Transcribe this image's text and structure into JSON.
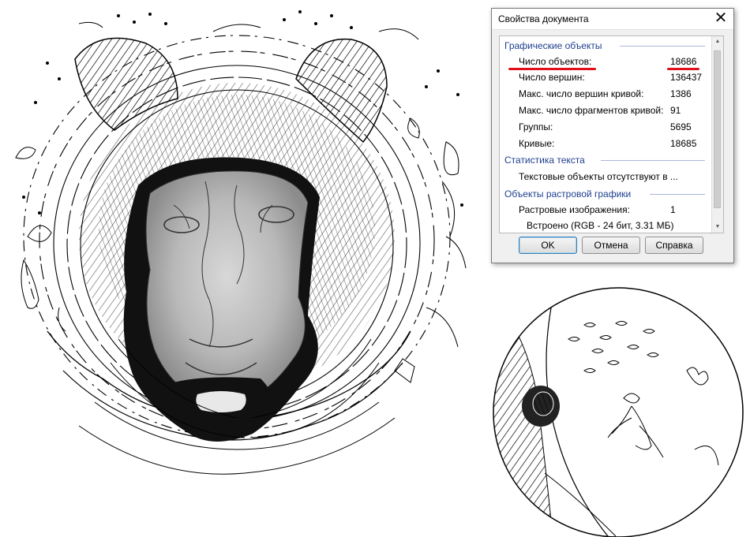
{
  "dialog": {
    "title": "Свойства документа",
    "close_glyph": "✕",
    "sections": [
      {
        "title": "Графические объекты",
        "rows": [
          {
            "label": "Число объектов:",
            "value": "18686"
          },
          {
            "label": "Число вершин:",
            "value": "136437"
          },
          {
            "label": "Макс. число вершин кривой:",
            "value": "1386"
          },
          {
            "label": "Макс. число фрагментов кривой:",
            "value": "91"
          },
          {
            "label": "Группы:",
            "value": "5695"
          },
          {
            "label": "Кривые:",
            "value": "18685"
          }
        ]
      },
      {
        "title": "Статистика текста",
        "rows": [
          {
            "label": "Текстовые объекты отсутствуют в ...",
            "value": ""
          }
        ]
      },
      {
        "title": "Объекты растровой графики",
        "rows": [
          {
            "label": "Растровые изображения:",
            "value": "1"
          },
          {
            "label": "Встроено (RGB - 24 бит, 3.31 МБ)",
            "value": ""
          }
        ]
      }
    ],
    "buttons": {
      "ok": "OK",
      "cancel": "Отмена",
      "help": "Справка"
    },
    "highlight_color": "#e0101a"
  },
  "artwork": {
    "main": "tiger-face-vector-trace",
    "inset": "circular-zoom-detail"
  }
}
